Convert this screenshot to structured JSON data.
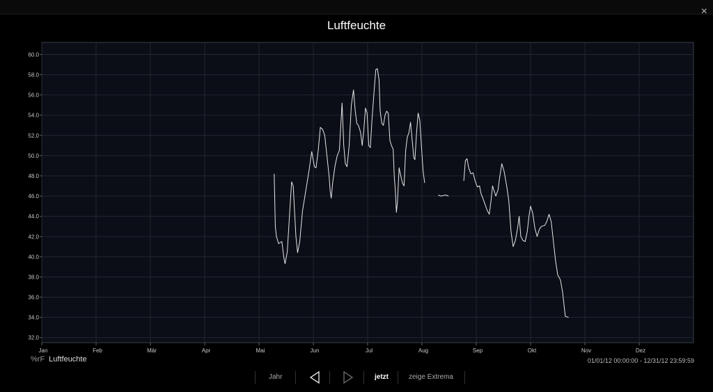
{
  "modal": {
    "title": "Luftfeuchte",
    "close_icon": "×"
  },
  "legend": {
    "unit": "%rF",
    "name": "Luftfeuchte"
  },
  "range_label": "01/01/12 00:00:00 - 12/31/12 23:59:59",
  "toolbar": {
    "year_label": "Jahr",
    "now_label": "jetzt",
    "extrema_label": "zeige Extrema"
  },
  "colors": {
    "background": "#000000",
    "plot_bg": "#0b0e16",
    "grid": "#262c38",
    "line": "#e8e8e8"
  },
  "chart_data": {
    "type": "line",
    "title": "Luftfeuchte",
    "x_ticks": [
      "Jan",
      "Feb",
      "Mär",
      "Apr",
      "Mai",
      "Jun",
      "Jul",
      "Aug",
      "Sep",
      "Okt",
      "Nov",
      "Dez"
    ],
    "y_ticks": [
      "32.0",
      "34.0",
      "36.0",
      "38.0",
      "40.0",
      "42.0",
      "44.0",
      "46.0",
      "48.0",
      "50.0",
      "52.0",
      "54.0",
      "56.0",
      "58.0",
      "60.0"
    ],
    "xlim": [
      0,
      12
    ],
    "ylim": [
      31.5,
      61.2
    ],
    "grid": true,
    "series": [
      {
        "name": "Luftfeuchte",
        "points": [
          [
            4.28,
            48.2
          ],
          [
            4.3,
            43.0
          ],
          [
            4.32,
            42.0
          ],
          [
            4.36,
            41.3
          ],
          [
            4.42,
            41.5
          ],
          [
            4.46,
            39.8
          ],
          [
            4.48,
            39.3
          ],
          [
            4.52,
            40.5
          ],
          [
            4.56,
            44.0
          ],
          [
            4.6,
            47.4
          ],
          [
            4.63,
            47.0
          ],
          [
            4.68,
            42.0
          ],
          [
            4.71,
            40.4
          ],
          [
            4.75,
            41.5
          ],
          [
            4.8,
            44.5
          ],
          [
            4.86,
            46.5
          ],
          [
            4.92,
            48.5
          ],
          [
            4.97,
            50.4
          ],
          [
            5.02,
            48.9
          ],
          [
            5.05,
            48.8
          ],
          [
            5.09,
            50.5
          ],
          [
            5.13,
            52.8
          ],
          [
            5.17,
            52.6
          ],
          [
            5.21,
            52.0
          ],
          [
            5.25,
            50.0
          ],
          [
            5.29,
            48.0
          ],
          [
            5.31,
            46.5
          ],
          [
            5.33,
            45.8
          ],
          [
            5.36,
            47.5
          ],
          [
            5.4,
            49.0
          ],
          [
            5.44,
            50.0
          ],
          [
            5.48,
            50.5
          ],
          [
            5.5,
            52.5
          ],
          [
            5.53,
            55.2
          ],
          [
            5.56,
            51.0
          ],
          [
            5.59,
            49.2
          ],
          [
            5.62,
            48.9
          ],
          [
            5.66,
            51.0
          ],
          [
            5.7,
            55.0
          ],
          [
            5.74,
            56.5
          ],
          [
            5.77,
            54.5
          ],
          [
            5.8,
            53.2
          ],
          [
            5.83,
            53.0
          ],
          [
            5.87,
            52.3
          ],
          [
            5.9,
            51.0
          ],
          [
            5.93,
            52.5
          ],
          [
            5.96,
            54.7
          ],
          [
            5.99,
            54.2
          ],
          [
            6.02,
            51.0
          ],
          [
            6.05,
            50.8
          ],
          [
            6.08,
            53.5
          ],
          [
            6.12,
            56.5
          ],
          [
            6.15,
            58.5
          ],
          [
            6.18,
            58.6
          ],
          [
            6.21,
            57.5
          ],
          [
            6.23,
            54.5
          ],
          [
            6.26,
            53.2
          ],
          [
            6.29,
            53.0
          ],
          [
            6.32,
            54.0
          ],
          [
            6.35,
            54.4
          ],
          [
            6.38,
            54.2
          ],
          [
            6.41,
            51.5
          ],
          [
            6.44,
            51.0
          ],
          [
            6.47,
            50.6
          ],
          [
            6.49,
            48.0
          ],
          [
            6.51,
            46.5
          ],
          [
            6.53,
            44.4
          ],
          [
            6.55,
            45.5
          ],
          [
            6.58,
            48.8
          ],
          [
            6.61,
            48.0
          ],
          [
            6.64,
            47.3
          ],
          [
            6.67,
            47.0
          ],
          [
            6.7,
            50.5
          ],
          [
            6.73,
            51.8
          ],
          [
            6.76,
            52.3
          ],
          [
            6.79,
            53.3
          ],
          [
            6.82,
            51.5
          ],
          [
            6.85,
            49.8
          ],
          [
            6.87,
            49.6
          ],
          [
            6.9,
            52.2
          ],
          [
            6.93,
            54.2
          ],
          [
            6.96,
            53.5
          ],
          [
            6.99,
            51.0
          ],
          [
            7.02,
            48.5
          ],
          [
            7.05,
            47.3
          ],
          null,
          [
            7.3,
            46.1
          ],
          [
            7.35,
            46.0
          ],
          [
            7.44,
            46.1
          ],
          [
            7.49,
            46.0
          ],
          null,
          [
            7.77,
            47.5
          ],
          [
            7.8,
            49.5
          ],
          [
            7.83,
            49.7
          ],
          [
            7.86,
            48.8
          ],
          [
            7.9,
            48.2
          ],
          [
            7.94,
            48.3
          ],
          [
            7.98,
            47.5
          ],
          [
            8.02,
            46.9
          ],
          [
            8.06,
            47.0
          ],
          [
            8.09,
            46.2
          ],
          [
            8.12,
            45.8
          ],
          [
            8.16,
            45.2
          ],
          [
            8.2,
            44.6
          ],
          [
            8.24,
            44.2
          ],
          [
            8.27,
            45.5
          ],
          [
            8.3,
            47.0
          ],
          [
            8.33,
            46.5
          ],
          [
            8.36,
            46.0
          ],
          [
            8.4,
            46.6
          ],
          [
            8.43,
            47.8
          ],
          [
            8.47,
            49.2
          ],
          [
            8.51,
            48.5
          ],
          [
            8.56,
            47.0
          ],
          [
            8.6,
            45.5
          ],
          [
            8.64,
            42.5
          ],
          [
            8.68,
            41.0
          ],
          [
            8.72,
            41.6
          ],
          [
            8.76,
            42.8
          ],
          [
            8.79,
            44.0
          ],
          [
            8.82,
            42.0
          ],
          [
            8.86,
            41.6
          ],
          [
            8.9,
            41.5
          ],
          [
            8.94,
            42.5
          ],
          [
            8.97,
            44.0
          ],
          [
            9.0,
            45.0
          ],
          [
            9.04,
            44.3
          ],
          [
            9.08,
            42.8
          ],
          [
            9.12,
            42.0
          ],
          [
            9.16,
            42.7
          ],
          [
            9.2,
            43.0
          ],
          [
            9.26,
            43.1
          ],
          [
            9.3,
            43.5
          ],
          [
            9.34,
            44.2
          ],
          [
            9.38,
            43.5
          ],
          [
            9.42,
            41.5
          ],
          [
            9.46,
            39.6
          ],
          [
            9.5,
            38.2
          ],
          [
            9.55,
            37.7
          ],
          [
            9.59,
            36.5
          ],
          [
            9.62,
            35.0
          ],
          [
            9.64,
            34.1
          ],
          [
            9.7,
            34.0
          ]
        ]
      }
    ]
  }
}
